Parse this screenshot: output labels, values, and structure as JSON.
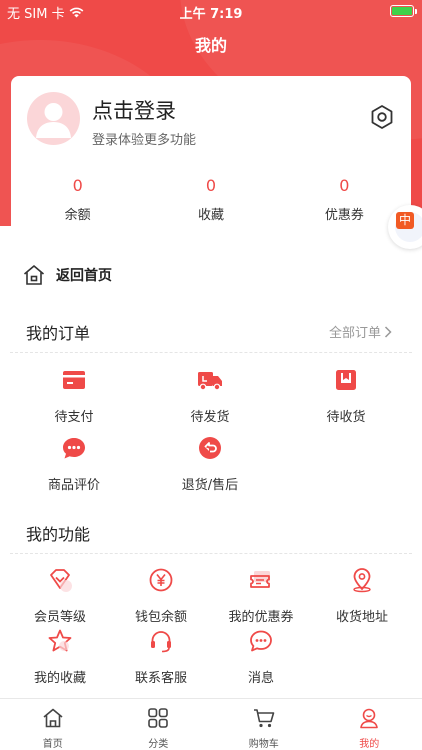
{
  "status": {
    "carrier": "无 SIM 卡",
    "time": "上午 7:19"
  },
  "header": {
    "title": "我的"
  },
  "profile": {
    "login_title": "点击登录",
    "login_sub": "登录体验更多功能"
  },
  "stats": [
    {
      "value": "0",
      "label": "余额"
    },
    {
      "value": "0",
      "label": "收藏"
    },
    {
      "value": "0",
      "label": "优惠券"
    }
  ],
  "float_badge": {
    "text": "中"
  },
  "home": {
    "label": "返回首页"
  },
  "orders": {
    "title": "我的订单",
    "see_all": "全部订单",
    "items": [
      {
        "label": "待支付",
        "icon": "card-icon"
      },
      {
        "label": "待发货",
        "icon": "truck-icon"
      },
      {
        "label": "待收货",
        "icon": "package-icon"
      },
      {
        "label": "商品评价",
        "icon": "comment-icon"
      },
      {
        "label": "退货/售后",
        "icon": "return-icon"
      }
    ]
  },
  "functions": {
    "title": "我的功能",
    "items": [
      {
        "label": "会员等级",
        "icon": "diamond-icon"
      },
      {
        "label": "钱包余额",
        "icon": "yen-icon"
      },
      {
        "label": "我的优惠券",
        "icon": "coupon-icon"
      },
      {
        "label": "收货地址",
        "icon": "location-icon"
      },
      {
        "label": "我的收藏",
        "icon": "star-icon"
      },
      {
        "label": "联系客服",
        "icon": "headset-icon"
      },
      {
        "label": "消息",
        "icon": "message-icon"
      }
    ]
  },
  "tabs": [
    {
      "label": "首页",
      "icon": "home-icon"
    },
    {
      "label": "分类",
      "icon": "category-icon"
    },
    {
      "label": "购物车",
      "icon": "cart-icon"
    },
    {
      "label": "我的",
      "icon": "user-icon"
    }
  ],
  "colors": {
    "accent": "#ef4a48",
    "light_accent": "#fbd6d8",
    "battery": "#3fd14a"
  }
}
